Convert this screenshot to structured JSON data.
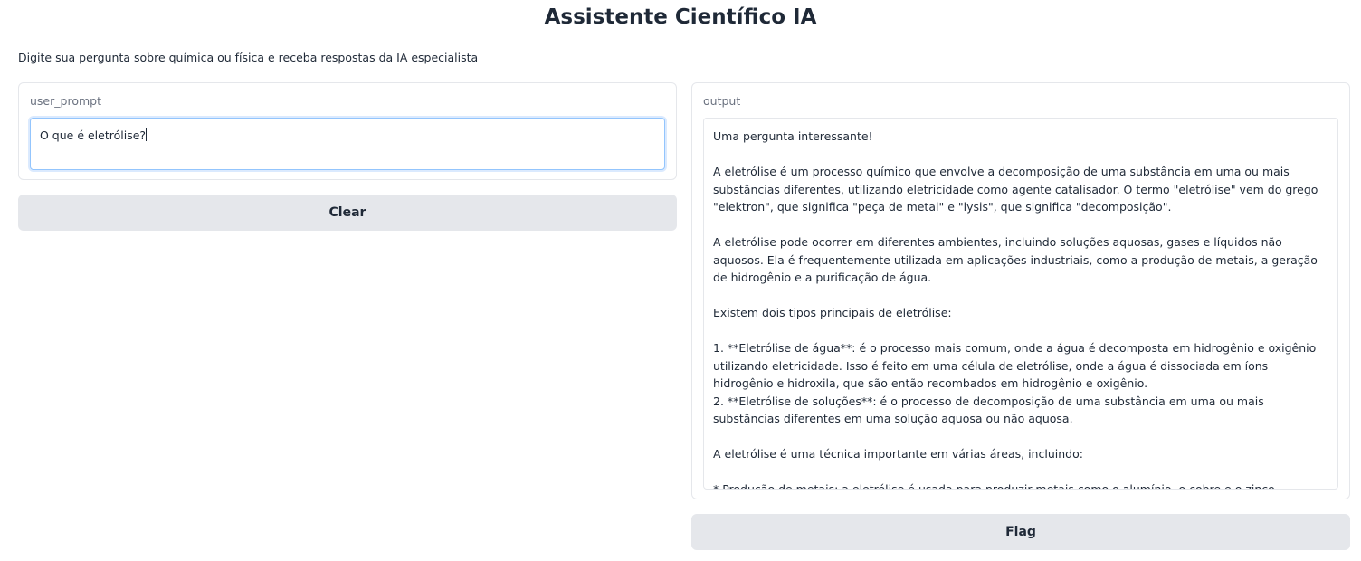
{
  "header": {
    "title": "Assistente Científico IA",
    "description": "Digite sua pergunta sobre química ou física e receba respostas da IA especialista"
  },
  "input_panel": {
    "label": "user_prompt",
    "value": "O que é eletrólise?"
  },
  "output_panel": {
    "label": "output",
    "text": "Uma pergunta interessante!\n\nA eletrólise é um processo químico que envolve a decomposição de uma substância em uma ou mais substâncias diferentes, utilizando eletricidade como agente catalisador. O termo \"eletrólise\" vem do grego \"elektron\", que significa \"peça de metal\" e \"lysis\", que significa \"decomposição\".\n\nA eletrólise pode ocorrer em diferentes ambientes, incluindo soluções aquosas, gases e líquidos não aquosos. Ela é frequentemente utilizada em aplicações industriais, como a produção de metais, a geração de hidrogênio e a purificação de água.\n\nExistem dois tipos principais de eletrólise:\n\n1. **Eletrólise de água**: é o processo mais comum, onde a água é decomposta em hidrogênio e oxigênio utilizando eletricidade. Isso é feito em uma célula de eletrólise, onde a água é dissociada em íons hidrogênio e hidroxila, que são então recombados em hidrogênio e oxigênio.\n2. **Eletrólise de soluções**: é o processo de decomposição de uma substância em uma ou mais substâncias diferentes em uma solução aquosa ou não aquosa.\n\nA eletrólise é uma técnica importante em várias áreas, incluindo:\n\n* Produção de metais: a eletrólise é usada para produzir metais como o alumínio, o cobre e o zinco."
  },
  "buttons": {
    "clear_label": "Clear",
    "flag_label": "Flag"
  }
}
